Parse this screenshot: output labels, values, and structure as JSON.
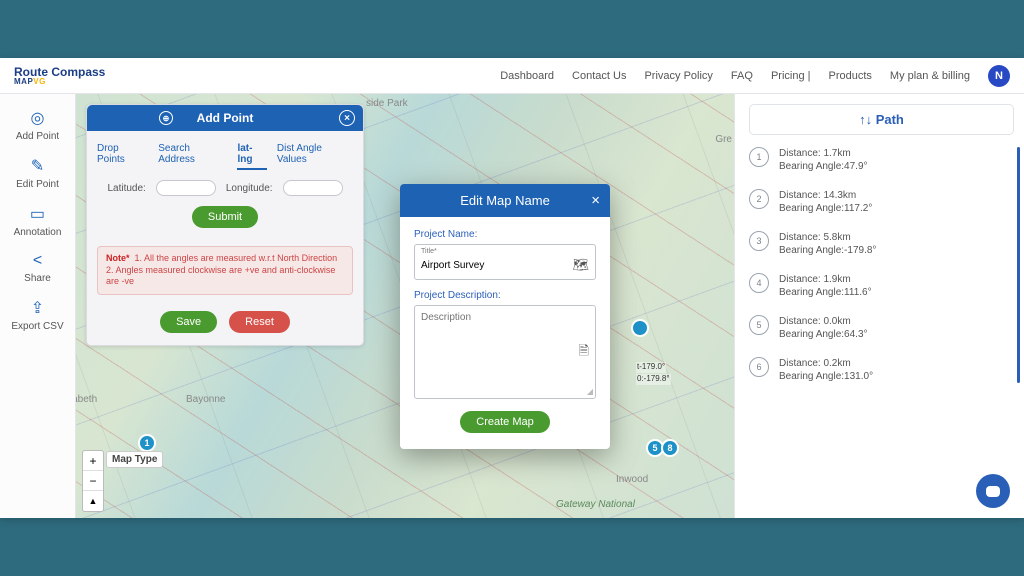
{
  "logo": {
    "line1": "Route Compass",
    "line2": "MAP"
  },
  "nav": {
    "dashboard": "Dashboard",
    "contact": "Contact Us",
    "privacy": "Privacy Policy",
    "faq": "FAQ",
    "pricing": "Pricing |",
    "products": "Products",
    "plan": "My plan & billing",
    "avatar": "N"
  },
  "sidebar": {
    "addpoint": "Add Point",
    "editpoint": "Edit Point",
    "annotation": "Annotation",
    "share": "Share",
    "exportcsv": "Export CSV"
  },
  "addpoint_panel": {
    "title": "Add Point",
    "tabs": {
      "drop": "Drop Points",
      "search": "Search Address",
      "latlng": "lat-lng",
      "distangle": "Dist Angle Values"
    },
    "lat_label": "Latitude:",
    "lng_label": "Longitude:",
    "submit": "Submit",
    "note_label": "Note*",
    "note_text": "1. All the angles are measured w.r.t North Direction\n2. Angles measured clockwise are +ve and anti-clockwise are -ve",
    "save": "Save",
    "reset": "Reset"
  },
  "modal": {
    "title": "Edit Map Name",
    "pname_label": "Project Name:",
    "title_tiny": "Title*",
    "title_value": "Airport Survey",
    "pdesc_label": "Project Description:",
    "desc_placeholder": "Description",
    "create": "Create Map"
  },
  "path_panel": {
    "header": "↑↓ Path",
    "nodes": [
      {
        "n": "1",
        "dist": "Distance: 1.7km",
        "ang": "Bearing Angle:47.9°"
      },
      {
        "n": "2",
        "dist": "Distance: 14.3km",
        "ang": "Bearing Angle:117.2°"
      },
      {
        "n": "3",
        "dist": "Distance: 5.8km",
        "ang": "Bearing Angle:-179.8°"
      },
      {
        "n": "4",
        "dist": "Distance: 1.9km",
        "ang": "Bearing Angle:111.6°"
      },
      {
        "n": "5",
        "dist": "Distance: 0.0km",
        "ang": "Bearing Angle:64.3°"
      },
      {
        "n": "6",
        "dist": "Distance: 0.2km",
        "ang": "Bearing Angle:131.0°"
      }
    ]
  },
  "map": {
    "maptype": "Map Type",
    "labels": {
      "elizabeth": "Elizabeth",
      "bayonne": "Bayonne",
      "inwood": "Inwood",
      "gateway": "Gateway\nNational",
      "sidepark": "side Park",
      "gre": "Gre"
    },
    "pins": {
      "p1": "1",
      "p5": "5",
      "p8": "8"
    },
    "anno": {
      "lat": "t-179.0°",
      "lng": "0:-179.8°"
    }
  }
}
